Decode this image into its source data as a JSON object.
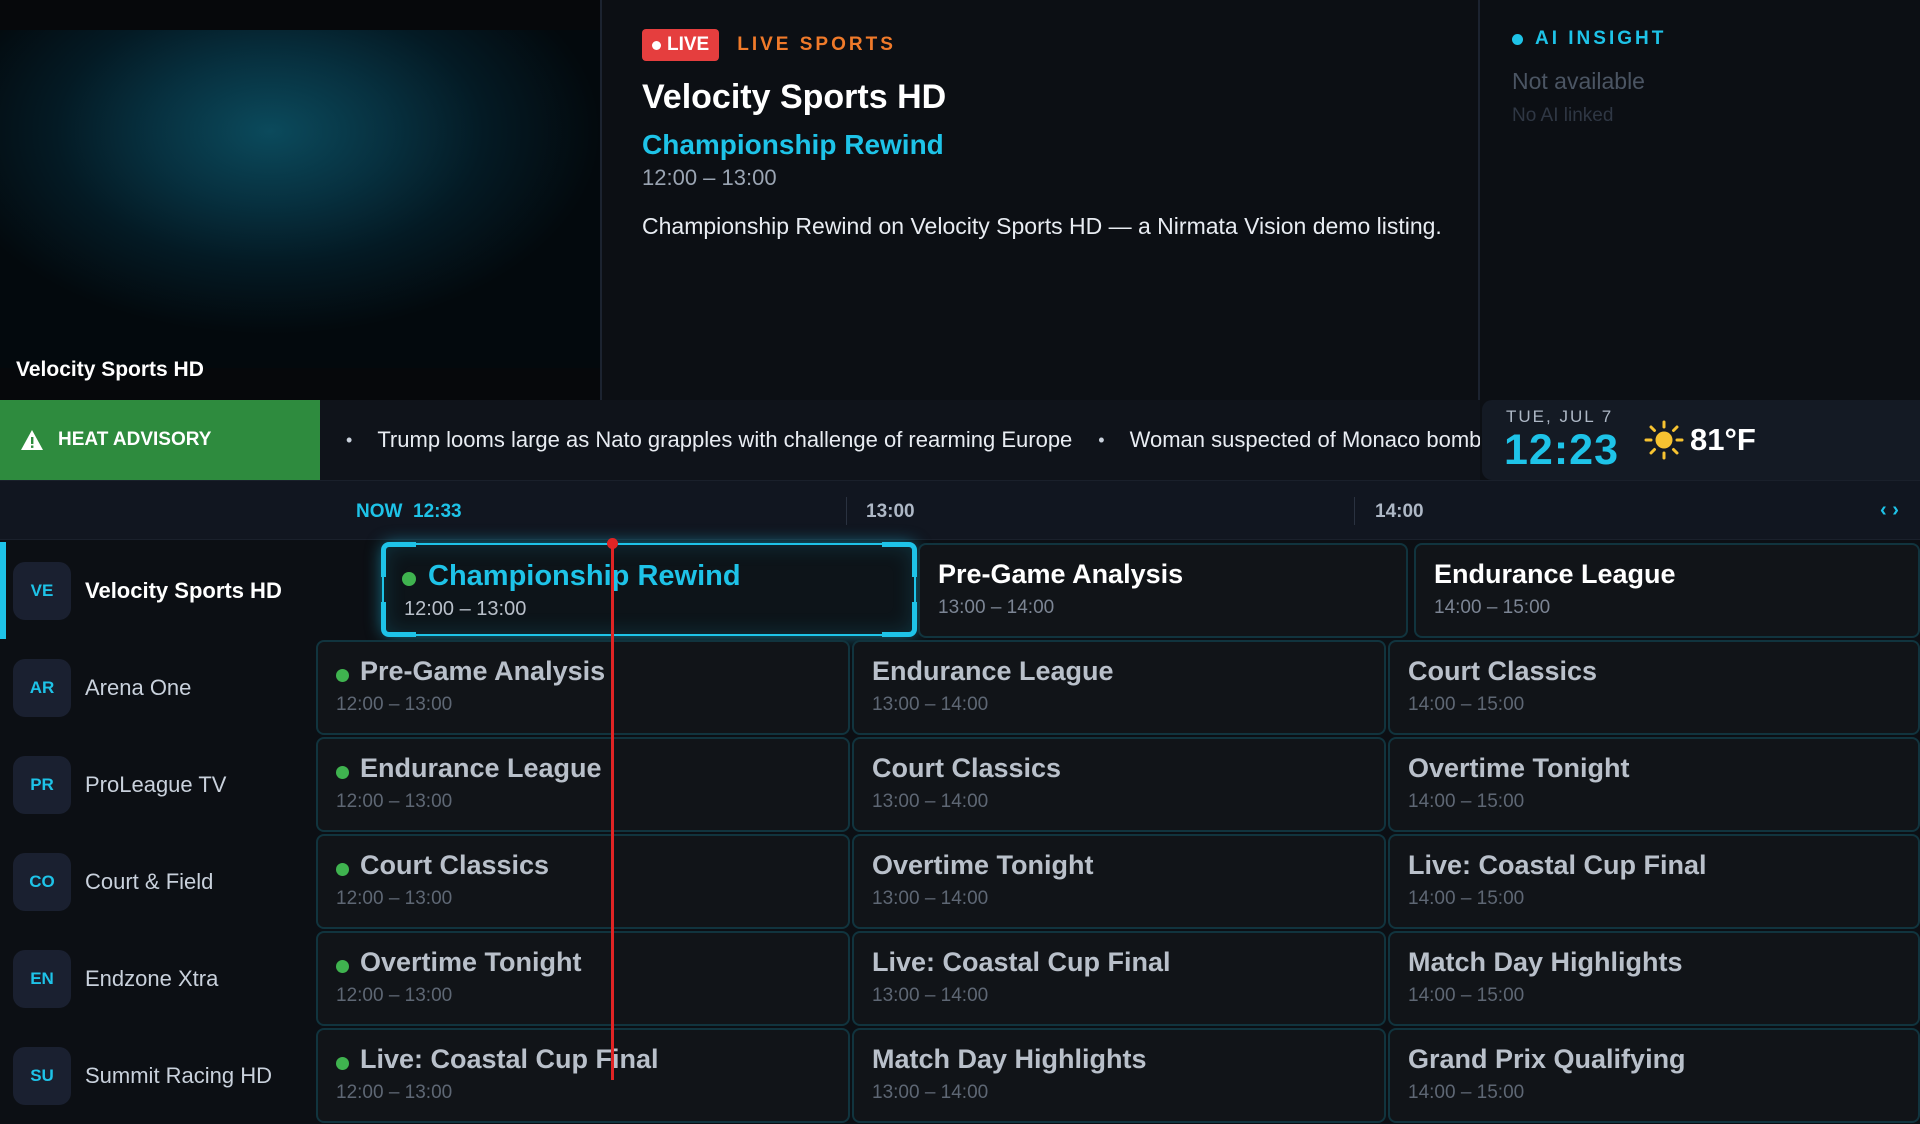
{
  "preview": {
    "channel_caption": "Velocity Sports HD"
  },
  "info": {
    "live_label": "LIVE",
    "category": "LIVE SPORTS",
    "channel": "Velocity Sports HD",
    "program": "Championship Rewind",
    "time": "12:00 – 13:00",
    "description": "Championship Rewind on Velocity Sports HD — a Nirmata Vision demo listing."
  },
  "ai": {
    "title": "AI INSIGHT",
    "status": "Not available",
    "sub": "No AI linked"
  },
  "alert": {
    "label": "HEAT ADVISORY"
  },
  "ticker": {
    "items": [
      "Trump looms large as Nato grapples with challenge of rearming Europe",
      "Woman suspected of Monaco bomb"
    ]
  },
  "clock": {
    "date": "TUE, JUL 7",
    "time": "12:23",
    "temp": "81°F"
  },
  "timeline": {
    "now_label": "NOW",
    "now_time": "12:33",
    "marks": [
      "13:00",
      "14:00"
    ],
    "nav": "‹ ›"
  },
  "channels": [
    {
      "abbr": "VE",
      "name": "Velocity Sports HD",
      "active": true,
      "programs": [
        {
          "title": "Championship Rewind",
          "time": "12:00 – 13:00"
        },
        {
          "title": "Pre-Game Analysis",
          "time": "13:00 – 14:00"
        },
        {
          "title": "Endurance League",
          "time": "14:00 – 15:00"
        }
      ]
    },
    {
      "abbr": "AR",
      "name": "Arena One",
      "programs": [
        {
          "title": "Pre-Game Analysis",
          "time": "12:00 – 13:00"
        },
        {
          "title": "Endurance League",
          "time": "13:00 – 14:00"
        },
        {
          "title": "Court Classics",
          "time": "14:00 – 15:00"
        }
      ]
    },
    {
      "abbr": "PR",
      "name": "ProLeague TV",
      "programs": [
        {
          "title": "Endurance League",
          "time": "12:00 – 13:00"
        },
        {
          "title": "Court Classics",
          "time": "13:00 – 14:00"
        },
        {
          "title": "Overtime Tonight",
          "time": "14:00 – 15:00"
        }
      ]
    },
    {
      "abbr": "CO",
      "name": "Court & Field",
      "programs": [
        {
          "title": "Court Classics",
          "time": "12:00 – 13:00"
        },
        {
          "title": "Overtime Tonight",
          "time": "13:00 – 14:00"
        },
        {
          "title": "Live: Coastal Cup Final",
          "time": "14:00 – 15:00"
        }
      ]
    },
    {
      "abbr": "EN",
      "name": "Endzone Xtra",
      "programs": [
        {
          "title": "Overtime Tonight",
          "time": "12:00 – 13:00"
        },
        {
          "title": "Live: Coastal Cup Final",
          "time": "13:00 – 14:00"
        },
        {
          "title": "Match Day Highlights",
          "time": "14:00 – 15:00"
        }
      ]
    },
    {
      "abbr": "SU",
      "name": "Summit Racing HD",
      "programs": [
        {
          "title": "Live: Coastal Cup Final",
          "time": "12:00 – 13:00"
        },
        {
          "title": "Match Day Highlights",
          "time": "13:00 – 14:00"
        },
        {
          "title": "Grand Prix Qualifying",
          "time": "14:00 – 15:00"
        }
      ]
    }
  ]
}
